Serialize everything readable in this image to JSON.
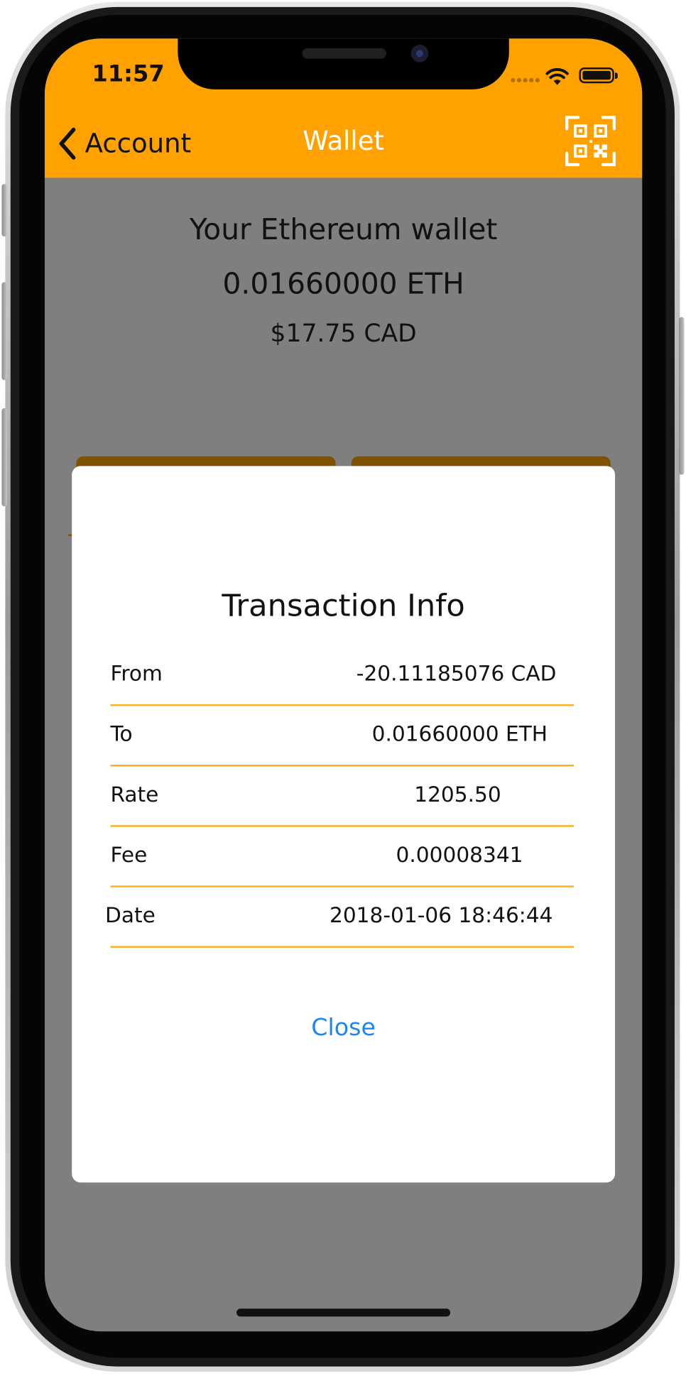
{
  "status_bar": {
    "time": "11:57"
  },
  "navbar": {
    "back_label": "Account",
    "title": "Wallet",
    "qr_icon": "qr-code-icon"
  },
  "wallet": {
    "title": "Your Ethereum wallet",
    "balance": "0.01660000 ETH",
    "fiat_value": "$17.75 CAD"
  },
  "modal": {
    "title": "Transaction Info",
    "rows": [
      {
        "label": "From",
        "value": "-20.11185076 CAD"
      },
      {
        "label": "To",
        "value": "0.01660000 ETH"
      },
      {
        "label": "Rate",
        "value": "1205.50"
      },
      {
        "label": "Fee",
        "value": "0.00008341"
      },
      {
        "label": "Date",
        "value": "2018-01-06 18:46:44"
      }
    ],
    "close_label": "Close"
  },
  "colors": {
    "accent": "#ffa200",
    "overlay": "#7f7f7f",
    "link": "#1d86f0",
    "divider": "#ffb020"
  }
}
